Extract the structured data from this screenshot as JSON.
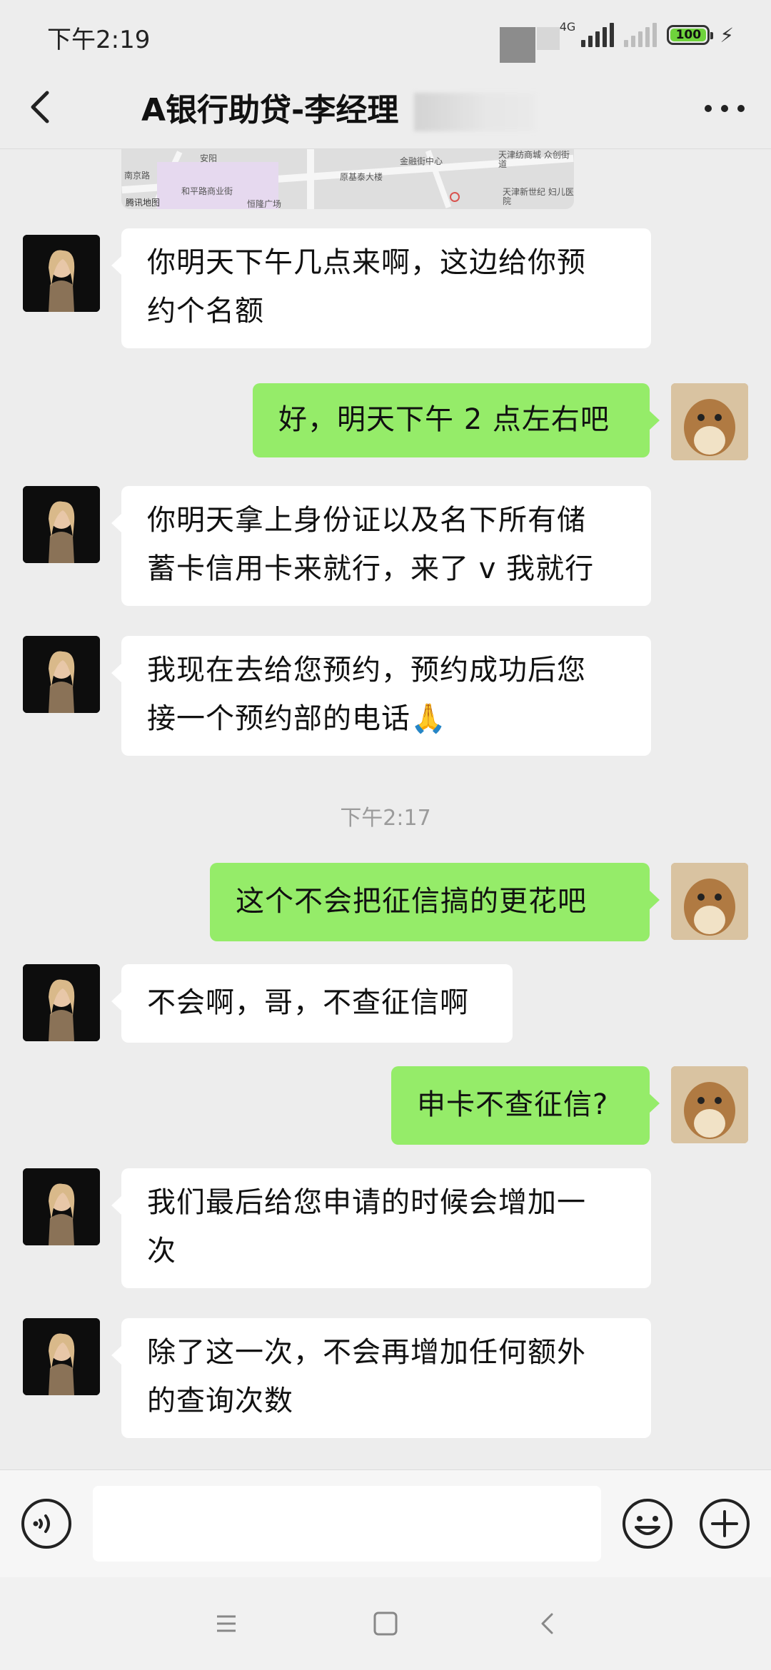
{
  "status_bar": {
    "time": "下午2:19",
    "network": "4G",
    "battery": "100"
  },
  "header": {
    "title": "A银行助贷-李经理"
  },
  "map_preview": {
    "labels": [
      "和平路商业街",
      "原基泰大楼",
      "金融街中心",
      "天津纺商城 众创街道",
      "天津新世纪 妇儿医院",
      "腾讯地图",
      "恒隆广场",
      "安阳",
      "南京路"
    ]
  },
  "messages": [
    {
      "side": "in",
      "text_lines": [
        "你明天下午几点来啊，这边给你预",
        "约个名额"
      ]
    },
    {
      "side": "out",
      "text_lines": [
        "好，明天下午 2 点左右吧"
      ]
    },
    {
      "side": "in",
      "text_lines": [
        "你明天拿上身份证以及名下所有储",
        "蓄卡信用卡来就行，来了 v 我就行"
      ]
    },
    {
      "side": "in",
      "text_lines": [
        "我现在去给您预约，预约成功后您",
        "接一个预约部的电话🙏"
      ]
    },
    {
      "side": "time",
      "text": "下午2:17"
    },
    {
      "side": "out",
      "text_lines": [
        "这个不会把征信搞的更花吧"
      ]
    },
    {
      "side": "in",
      "text_lines": [
        "不会啊，哥，不查征信啊"
      ]
    },
    {
      "side": "out",
      "text_lines": [
        "申卡不查征信?"
      ]
    },
    {
      "side": "in",
      "text_lines": [
        "我们最后给您申请的时候会增加一",
        "次"
      ]
    },
    {
      "side": "in",
      "text_lines": [
        "除了这一次，不会再增加任何额外",
        "的查询次数"
      ]
    }
  ],
  "input_bar": {
    "value": "",
    "placeholder": ""
  },
  "icons": {
    "back": "chevron-left-icon",
    "more": "more-dots-icon",
    "voice": "voice-icon",
    "emoji": "emoji-icon",
    "plus": "plus-icon",
    "nav_menu": "menu-lines-icon",
    "nav_home": "home-square-icon",
    "nav_back": "back-triangle-icon"
  },
  "colors": {
    "incoming_bubble": "#ffffff",
    "outgoing_bubble": "#95ec69",
    "background": "#ededed",
    "battery_fill": "#6fd33c"
  }
}
